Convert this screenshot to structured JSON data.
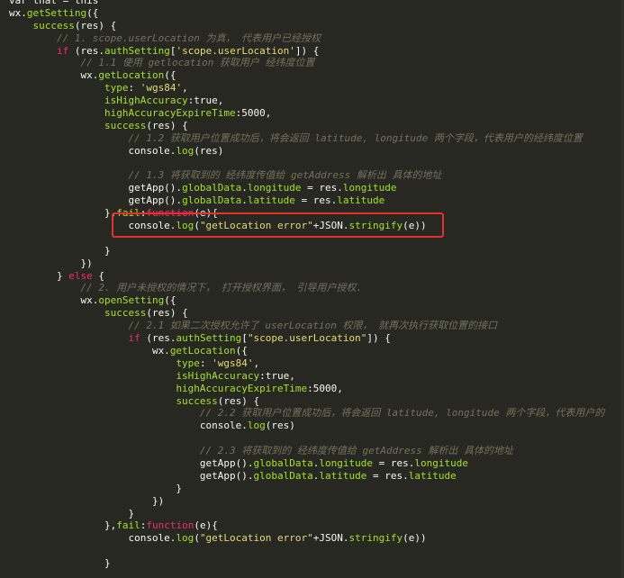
{
  "editor": {
    "lines": [
      [
        {
          "t": "var that = this",
          "c": "ident"
        }
      ],
      [
        {
          "t": "wx.",
          "c": "ident"
        },
        {
          "t": "getSetting",
          "c": "func"
        },
        {
          "t": "({",
          "c": "ident"
        }
      ],
      [
        {
          "t": "    ",
          "c": "ident"
        },
        {
          "t": "success",
          "c": "property"
        },
        {
          "t": "(res) {",
          "c": "ident"
        }
      ],
      [
        {
          "t": "        ",
          "c": "ident"
        },
        {
          "t": "// 1. scope.userLocation 为真， 代表用户已经授权",
          "c": "comment"
        }
      ],
      [
        {
          "t": "        ",
          "c": "ident"
        },
        {
          "t": "if",
          "c": "keyword"
        },
        {
          "t": " (res.",
          "c": "ident"
        },
        {
          "t": "authSetting",
          "c": "property"
        },
        {
          "t": "[",
          "c": "ident"
        },
        {
          "t": "'scope.userLocation'",
          "c": "string"
        },
        {
          "t": "]) {",
          "c": "ident"
        }
      ],
      [
        {
          "t": "            ",
          "c": "ident"
        },
        {
          "t": "// 1.1 使用 getlocation 获取用户 经纬度位置",
          "c": "comment"
        }
      ],
      [
        {
          "t": "            wx.",
          "c": "ident"
        },
        {
          "t": "getLocation",
          "c": "func"
        },
        {
          "t": "({",
          "c": "ident"
        }
      ],
      [
        {
          "t": "                ",
          "c": "ident"
        },
        {
          "t": "type",
          "c": "property"
        },
        {
          "t": ": ",
          "c": "ident"
        },
        {
          "t": "'wgs84'",
          "c": "string"
        },
        {
          "t": ",",
          "c": "ident"
        }
      ],
      [
        {
          "t": "                ",
          "c": "ident"
        },
        {
          "t": "isHighAccuracy",
          "c": "property"
        },
        {
          "t": ":true,",
          "c": "ident"
        }
      ],
      [
        {
          "t": "                ",
          "c": "ident"
        },
        {
          "t": "highAccuracyExpireTime",
          "c": "property"
        },
        {
          "t": ":5000,",
          "c": "ident"
        }
      ],
      [
        {
          "t": "                ",
          "c": "ident"
        },
        {
          "t": "success",
          "c": "property"
        },
        {
          "t": "(res) {",
          "c": "ident"
        }
      ],
      [
        {
          "t": "                    ",
          "c": "ident"
        },
        {
          "t": "// 1.2 获取用户位置成功后，将会返回 latitude, longitude 两个字段，代表用户的经纬度位置",
          "c": "comment"
        }
      ],
      [
        {
          "t": "                    console.",
          "c": "ident"
        },
        {
          "t": "log",
          "c": "func"
        },
        {
          "t": "(res)",
          "c": "ident"
        }
      ],
      [
        {
          "t": "",
          "c": "ident"
        }
      ],
      [
        {
          "t": "                    ",
          "c": "ident"
        },
        {
          "t": "// 1.3 将获取到的 经纬度传值给 getAddress 解析出 具体的地址",
          "c": "comment"
        }
      ],
      [
        {
          "t": "                    getApp().",
          "c": "ident"
        },
        {
          "t": "globalData",
          "c": "property"
        },
        {
          "t": ".",
          "c": "ident"
        },
        {
          "t": "longitude",
          "c": "property"
        },
        {
          "t": " = res.",
          "c": "ident"
        },
        {
          "t": "longitude",
          "c": "property"
        }
      ],
      [
        {
          "t": "                    getApp().",
          "c": "ident"
        },
        {
          "t": "globalData",
          "c": "property"
        },
        {
          "t": ".",
          "c": "ident"
        },
        {
          "t": "latitude",
          "c": "property"
        },
        {
          "t": " = res.",
          "c": "ident"
        },
        {
          "t": "latitude",
          "c": "property"
        }
      ],
      [
        {
          "t": "                },",
          "c": "ident"
        },
        {
          "t": "fail",
          "c": "property"
        },
        {
          "t": ":",
          "c": "ident"
        },
        {
          "t": "function",
          "c": "keyword"
        },
        {
          "t": "(e){",
          "c": "ident"
        }
      ],
      [
        {
          "t": "                    console.",
          "c": "ident"
        },
        {
          "t": "log",
          "c": "func"
        },
        {
          "t": "(",
          "c": "ident"
        },
        {
          "t": "\"getLocation error\"",
          "c": "string"
        },
        {
          "t": "+JSON.",
          "c": "ident"
        },
        {
          "t": "stringify",
          "c": "func"
        },
        {
          "t": "(e))",
          "c": "ident"
        }
      ],
      [
        {
          "t": "",
          "c": "ident"
        }
      ],
      [
        {
          "t": "                }",
          "c": "ident"
        }
      ],
      [
        {
          "t": "            })",
          "c": "ident"
        }
      ],
      [
        {
          "t": "        } ",
          "c": "ident"
        },
        {
          "t": "else",
          "c": "keyword"
        },
        {
          "t": " {",
          "c": "ident"
        }
      ],
      [
        {
          "t": "            ",
          "c": "ident"
        },
        {
          "t": "// 2. 用户未授权的情况下， 打开授权界面， 引导用户授权.",
          "c": "comment"
        }
      ],
      [
        {
          "t": "            wx.",
          "c": "ident"
        },
        {
          "t": "openSetting",
          "c": "func"
        },
        {
          "t": "({",
          "c": "ident"
        }
      ],
      [
        {
          "t": "                ",
          "c": "ident"
        },
        {
          "t": "success",
          "c": "property"
        },
        {
          "t": "(res) {",
          "c": "ident"
        }
      ],
      [
        {
          "t": "                    ",
          "c": "ident"
        },
        {
          "t": "// 2.1 如果二次授权允许了 userLocation 权限， 就再次执行获取位置的接口",
          "c": "comment"
        }
      ],
      [
        {
          "t": "                    ",
          "c": "ident"
        },
        {
          "t": "if",
          "c": "keyword"
        },
        {
          "t": " (res.",
          "c": "ident"
        },
        {
          "t": "authSetting",
          "c": "property"
        },
        {
          "t": "[",
          "c": "ident"
        },
        {
          "t": "\"scope.userLocation\"",
          "c": "string"
        },
        {
          "t": "]) {",
          "c": "ident"
        }
      ],
      [
        {
          "t": "                        wx.",
          "c": "ident"
        },
        {
          "t": "getLocation",
          "c": "func"
        },
        {
          "t": "({",
          "c": "ident"
        }
      ],
      [
        {
          "t": "                            ",
          "c": "ident"
        },
        {
          "t": "type",
          "c": "property"
        },
        {
          "t": ": ",
          "c": "ident"
        },
        {
          "t": "'wgs84'",
          "c": "string"
        },
        {
          "t": ",",
          "c": "ident"
        }
      ],
      [
        {
          "t": "                            ",
          "c": "ident"
        },
        {
          "t": "isHighAccuracy",
          "c": "property"
        },
        {
          "t": ":true,",
          "c": "ident"
        }
      ],
      [
        {
          "t": "                            ",
          "c": "ident"
        },
        {
          "t": "highAccuracyExpireTime",
          "c": "property"
        },
        {
          "t": ":5000,",
          "c": "ident"
        }
      ],
      [
        {
          "t": "                            ",
          "c": "ident"
        },
        {
          "t": "success",
          "c": "property"
        },
        {
          "t": "(res) {",
          "c": "ident"
        }
      ],
      [
        {
          "t": "                                ",
          "c": "ident"
        },
        {
          "t": "// 2.2 获取用户位置成功后，将会返回 latitude, longitude 两个字段，代表用户的",
          "c": "comment"
        }
      ],
      [
        {
          "t": "                                console.",
          "c": "ident"
        },
        {
          "t": "log",
          "c": "func"
        },
        {
          "t": "(res)",
          "c": "ident"
        }
      ],
      [
        {
          "t": "",
          "c": "ident"
        }
      ],
      [
        {
          "t": "                                ",
          "c": "ident"
        },
        {
          "t": "// 2.3 将获取到的 经纬度传值给 getAddress 解析出 具体的地址",
          "c": "comment"
        }
      ],
      [
        {
          "t": "                                getApp().",
          "c": "ident"
        },
        {
          "t": "globalData",
          "c": "property"
        },
        {
          "t": ".",
          "c": "ident"
        },
        {
          "t": "longitude",
          "c": "property"
        },
        {
          "t": " = res.",
          "c": "ident"
        },
        {
          "t": "longitude",
          "c": "property"
        }
      ],
      [
        {
          "t": "                                getApp().",
          "c": "ident"
        },
        {
          "t": "globalData",
          "c": "property"
        },
        {
          "t": ".",
          "c": "ident"
        },
        {
          "t": "latitude",
          "c": "property"
        },
        {
          "t": " = res.",
          "c": "ident"
        },
        {
          "t": "latitude",
          "c": "property"
        }
      ],
      [
        {
          "t": "                            }",
          "c": "ident"
        }
      ],
      [
        {
          "t": "                        })",
          "c": "ident"
        }
      ],
      [
        {
          "t": "                    }",
          "c": "ident"
        }
      ],
      [
        {
          "t": "                },",
          "c": "ident"
        },
        {
          "t": "fail",
          "c": "property"
        },
        {
          "t": ":",
          "c": "ident"
        },
        {
          "t": "function",
          "c": "keyword"
        },
        {
          "t": "(e){",
          "c": "ident"
        }
      ],
      [
        {
          "t": "                    console.",
          "c": "ident"
        },
        {
          "t": "log",
          "c": "func"
        },
        {
          "t": "(",
          "c": "ident"
        },
        {
          "t": "\"getLocation error\"",
          "c": "string"
        },
        {
          "t": "+JSON.",
          "c": "ident"
        },
        {
          "t": "stringify",
          "c": "func"
        },
        {
          "t": "(e))",
          "c": "ident"
        }
      ],
      [
        {
          "t": "",
          "c": "ident"
        }
      ],
      [
        {
          "t": "                }",
          "c": "ident"
        }
      ]
    ]
  },
  "colors": {
    "background": "#272822",
    "highlight_box": "#e8302a",
    "comment": "#75715e",
    "string": "#e6db74",
    "keyword": "#f92672",
    "property": "#a6e22e",
    "identifier": "#f8f8f2"
  }
}
